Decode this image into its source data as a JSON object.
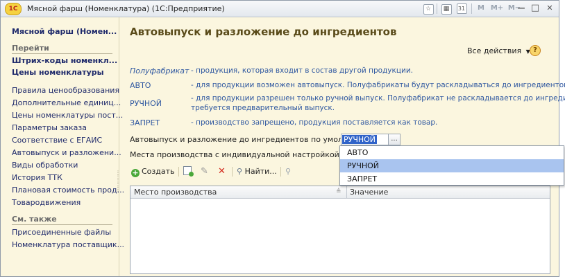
{
  "window": {
    "title": "Мясной фарш (Номенклатура)  (1С:Предприятие)",
    "logo_text": "1С",
    "toolbar_icons": [
      "favorites-icon",
      "calculator-icon",
      "calendar-icon"
    ],
    "memory_buttons": [
      "M",
      "M+",
      "M−"
    ],
    "minimize": "—",
    "maximize": "□",
    "close": "✕"
  },
  "sidebar": {
    "title": "Мясной фарш (Номен...",
    "go_section": "Перейти",
    "primary_links": [
      "Штрих-коды номенкл...",
      "Цены номенклатуры"
    ],
    "items": [
      "Правила ценообразования",
      "Дополнительные единиц...",
      "Цены номенклатуры пост...",
      "Параметры заказа",
      "Соответствие с ЕГАИС",
      "Автовыпуск и разложени...",
      "Виды обработки",
      "История ТТК",
      "Плановая стоимость прод...",
      "Товародвижения"
    ],
    "see_also_section": "См. также",
    "see_also_items": [
      "Присоединенные файлы",
      "Номенклатура поставщик..."
    ]
  },
  "main": {
    "title": "Автовыпуск и разложение до ингредиентов",
    "all_actions": "Все действия",
    "help": "?",
    "definitions": [
      {
        "term": "Полуфабрикат",
        "text": "- продукция, которая входит в состав другой продукции."
      },
      {
        "term": "АВТО",
        "text": "- для продукции возможен автовыпуск. Полуфабрикаты будут  раскладываться до ингредиентов."
      },
      {
        "term": "РУЧНОЙ",
        "text": "- для продукции разрешен только ручной выпуск. Полуфабрикат не раскладывается до ингредиентов,",
        "text2": "требуется предварительный выпуск."
      },
      {
        "term": "ЗАПРЕТ",
        "text": "- производство запрещено, продукция поставляется  как товар."
      }
    ],
    "default_label": "Автовыпуск и разложение до ингредиентов по умолчанию:",
    "default_value": "РУЧНОЙ",
    "combo_button": "...",
    "places_label": "Места производства с индивидуальной настройкой:",
    "toolbar": {
      "create": "Создать",
      "find": "Найти..."
    },
    "grid": {
      "columns": [
        "Место производства",
        "Значение"
      ]
    }
  },
  "dropdown": {
    "options": [
      "АВТО",
      "РУЧНОЙ",
      "ЗАПРЕТ"
    ],
    "selected": "РУЧНОЙ"
  },
  "colors": {
    "background": "#fbf6df",
    "link": "#1f2a6b",
    "definition": "#2e57a0",
    "title": "#5a4b1a",
    "selection": "#3063c9",
    "dropdown_highlight": "#a9c4ef"
  }
}
